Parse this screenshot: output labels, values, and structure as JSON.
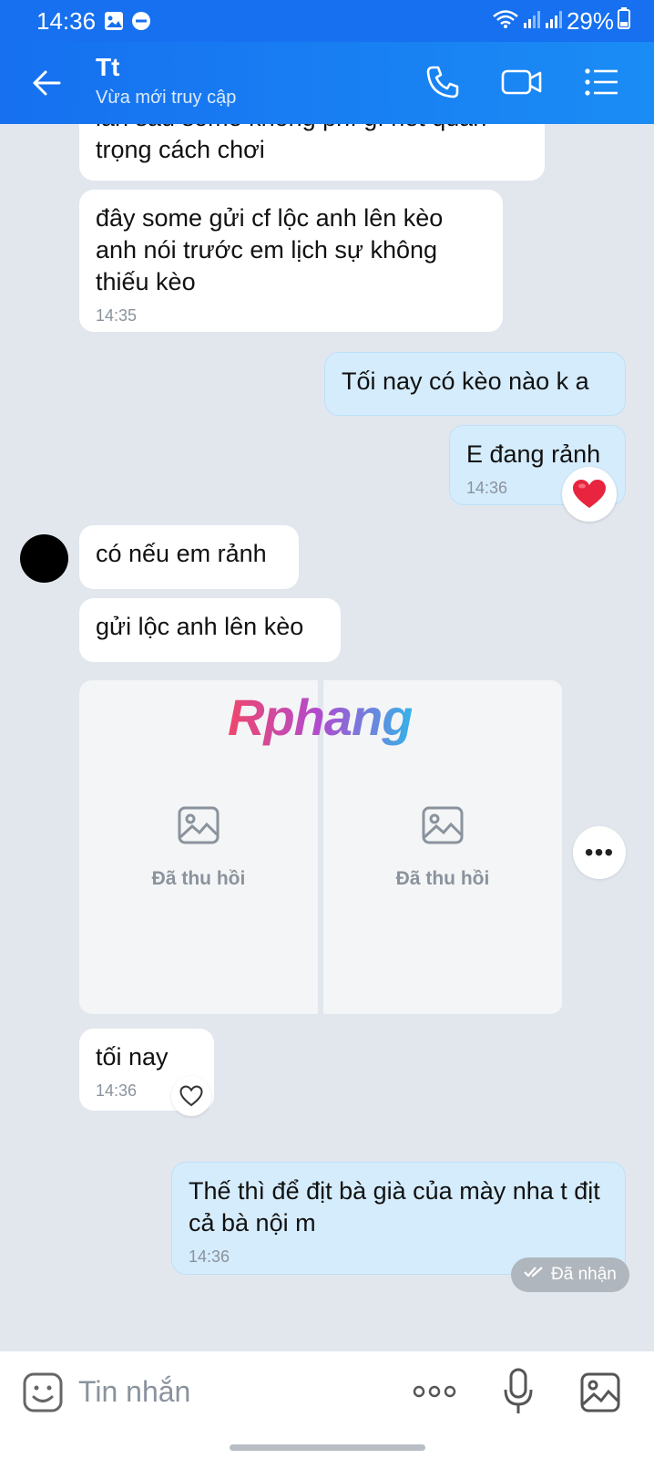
{
  "status_bar": {
    "time": "14:36",
    "battery": "29%"
  },
  "header": {
    "contact_name": "Tt",
    "contact_status": "Vừa mới truy cập"
  },
  "messages": [
    {
      "text": "lần sau some không phí gì hết quan trọng cách chơi"
    },
    {
      "text": "đây some gửi cf lộc anh lên kèo anh nói trước em lịch sự không thiếu kèo",
      "time": "14:35"
    },
    {
      "text": "Tối nay có kèo nào k a"
    },
    {
      "text": "E đang rảnh",
      "time": "14:36"
    },
    {
      "text": "có nếu em rảnh"
    },
    {
      "text": "gửi lộc anh lên kèo"
    },
    {
      "recalled_label_1": "Đã thu hồi",
      "recalled_label_2": "Đã thu hồi"
    },
    {
      "text": "tối nay",
      "time": "14:36"
    },
    {
      "text": "Thế thì để địt bà già của mày nha t địt cả bà nội m",
      "time": "14:36"
    }
  ],
  "watermark": "Rphang",
  "delivery_status": "Đã nhận",
  "composer": {
    "placeholder": "Tin nhắn"
  },
  "colors": {
    "header": "#1670f0",
    "chat_bg": "#e2e7ee",
    "outgoing_bubble": "#d5ecfc",
    "incoming_bubble": "#ffffff"
  }
}
